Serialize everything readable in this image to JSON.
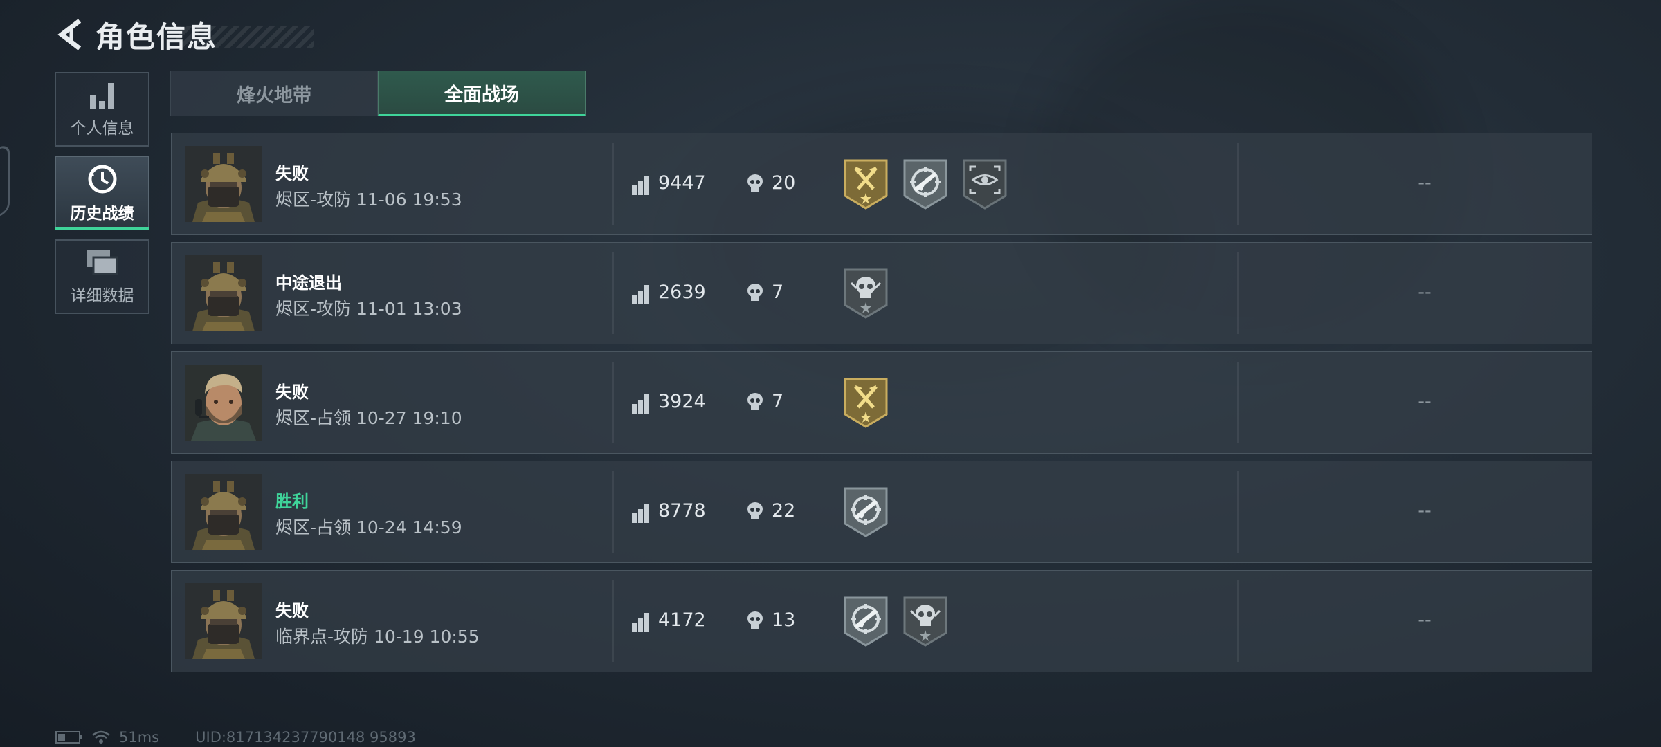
{
  "header": {
    "title": "角色信息"
  },
  "side_nav": [
    {
      "label": "个人信息",
      "icon": "bar-chart-icon",
      "active": false
    },
    {
      "label": "历史战绩",
      "icon": "clock-history-icon",
      "active": true
    },
    {
      "label": "详细数据",
      "icon": "stacked-cards-icon",
      "active": false
    }
  ],
  "tabs": [
    {
      "label": "烽火地带",
      "active": false
    },
    {
      "label": "全面战场",
      "active": true
    }
  ],
  "matches": [
    {
      "result": "失败",
      "mode": "烬区-攻防 11-06 19:53",
      "score": "9447",
      "kills": "20",
      "badges": [
        "gold-flag-badge",
        "rifle-target-badge",
        "eye-scope-badge"
      ],
      "extra": "--",
      "avatar": "helmet-soldier"
    },
    {
      "result": "中途退出",
      "mode": "烬区-攻防 11-01 13:03",
      "score": "2639",
      "kills": "7",
      "badges": [
        "skull-badge"
      ],
      "extra": "--",
      "avatar": "helmet-soldier"
    },
    {
      "result": "失败",
      "mode": "烬区-占领 10-27 19:10",
      "score": "3924",
      "kills": "7",
      "badges": [
        "gold-flag-badge"
      ],
      "extra": "--",
      "avatar": "bearded-soldier"
    },
    {
      "result": "胜利",
      "mode": "烬区-占领 10-24 14:59",
      "score": "8778",
      "kills": "22",
      "badges": [
        "rifle-target-badge"
      ],
      "extra": "--",
      "avatar": "helmet-soldier"
    },
    {
      "result": "失败",
      "mode": "临界点-攻防 10-19 10:55",
      "score": "4172",
      "kills": "13",
      "badges": [
        "rifle-target-badge",
        "skull-badge"
      ],
      "extra": "--",
      "avatar": "helmet-soldier"
    }
  ],
  "footer": {
    "ping": "51ms",
    "uid": "UID:817134237790148 95893"
  },
  "colors": {
    "accent": "#3fd49a",
    "gold": "#d9c06a",
    "win": "#3fd49a"
  }
}
